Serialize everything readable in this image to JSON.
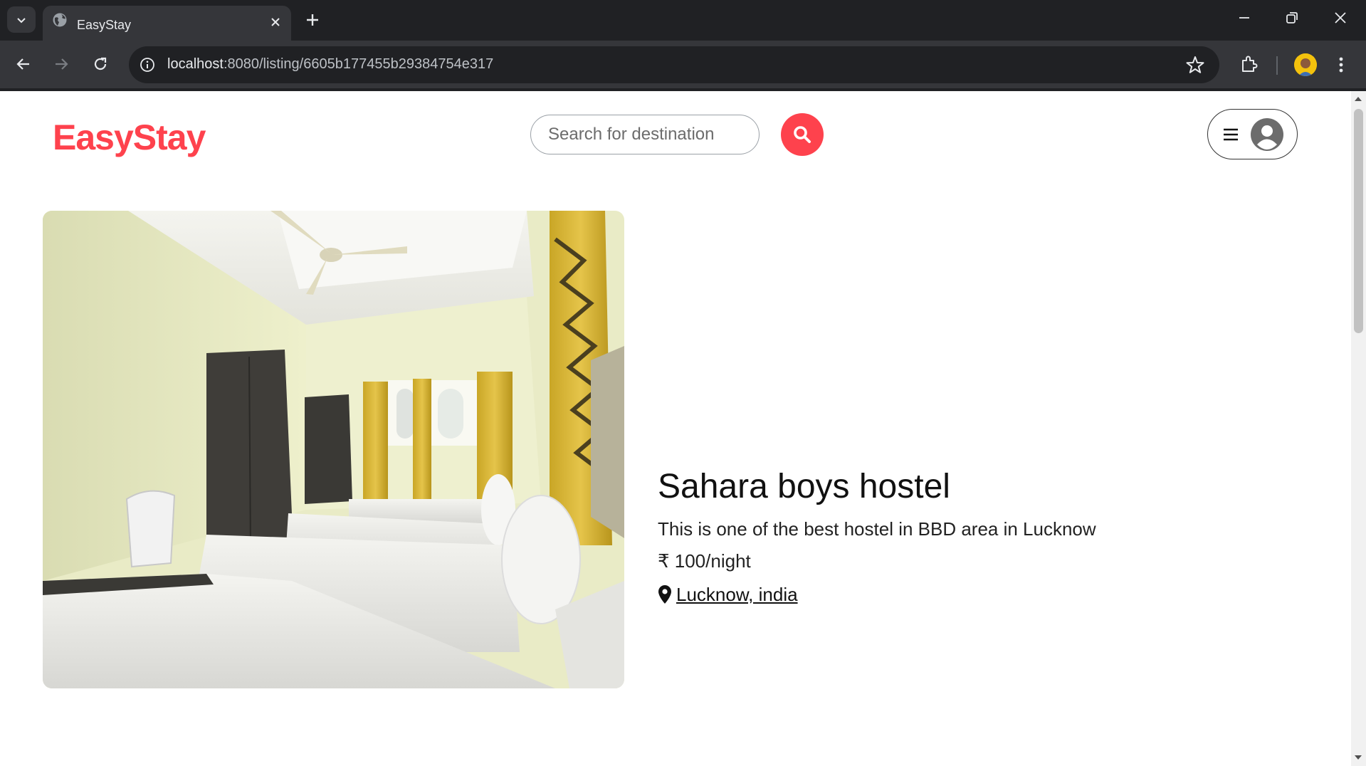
{
  "browser": {
    "tab_title": "EasyStay",
    "url_host": "localhost",
    "url_path": ":8080/listing/6605b177455b29384754e317"
  },
  "site": {
    "logo": "EasyStay",
    "brand_color": "#fe424d",
    "search_placeholder": "Search for destination"
  },
  "listing": {
    "title": "Sahara boys hostel",
    "description": "This is one of the best hostel in BBD area in Lucknow",
    "price": "₹ 100/night",
    "location": " Lucknow, india"
  }
}
